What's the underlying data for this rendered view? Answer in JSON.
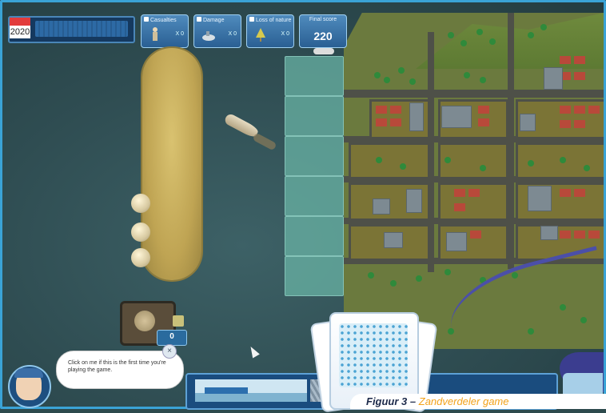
{
  "hud": {
    "year": "2020",
    "stats": [
      {
        "label": "Casualties",
        "value": "X 0",
        "icon": "person-icon"
      },
      {
        "label": "Damage",
        "value": "X 0",
        "icon": "damage-icon"
      },
      {
        "label": "Loss of nature",
        "value": "X 0",
        "icon": "nature-icon"
      }
    ],
    "score_label": "Final score",
    "score_value": "220"
  },
  "dredge": {
    "count": "0"
  },
  "tutorial": {
    "message": "Click on me if this is the first time you're playing the game.",
    "close_symbol": "×"
  },
  "caption": {
    "prefix": "Figuur 3 –",
    "title": "Zandverdeler game"
  },
  "colors": {
    "frame": "#3aa3d6",
    "water": "#2f4d52",
    "sand": "#bfa453",
    "tile": "#6cb9aa",
    "caption_title": "#f2a21a"
  }
}
